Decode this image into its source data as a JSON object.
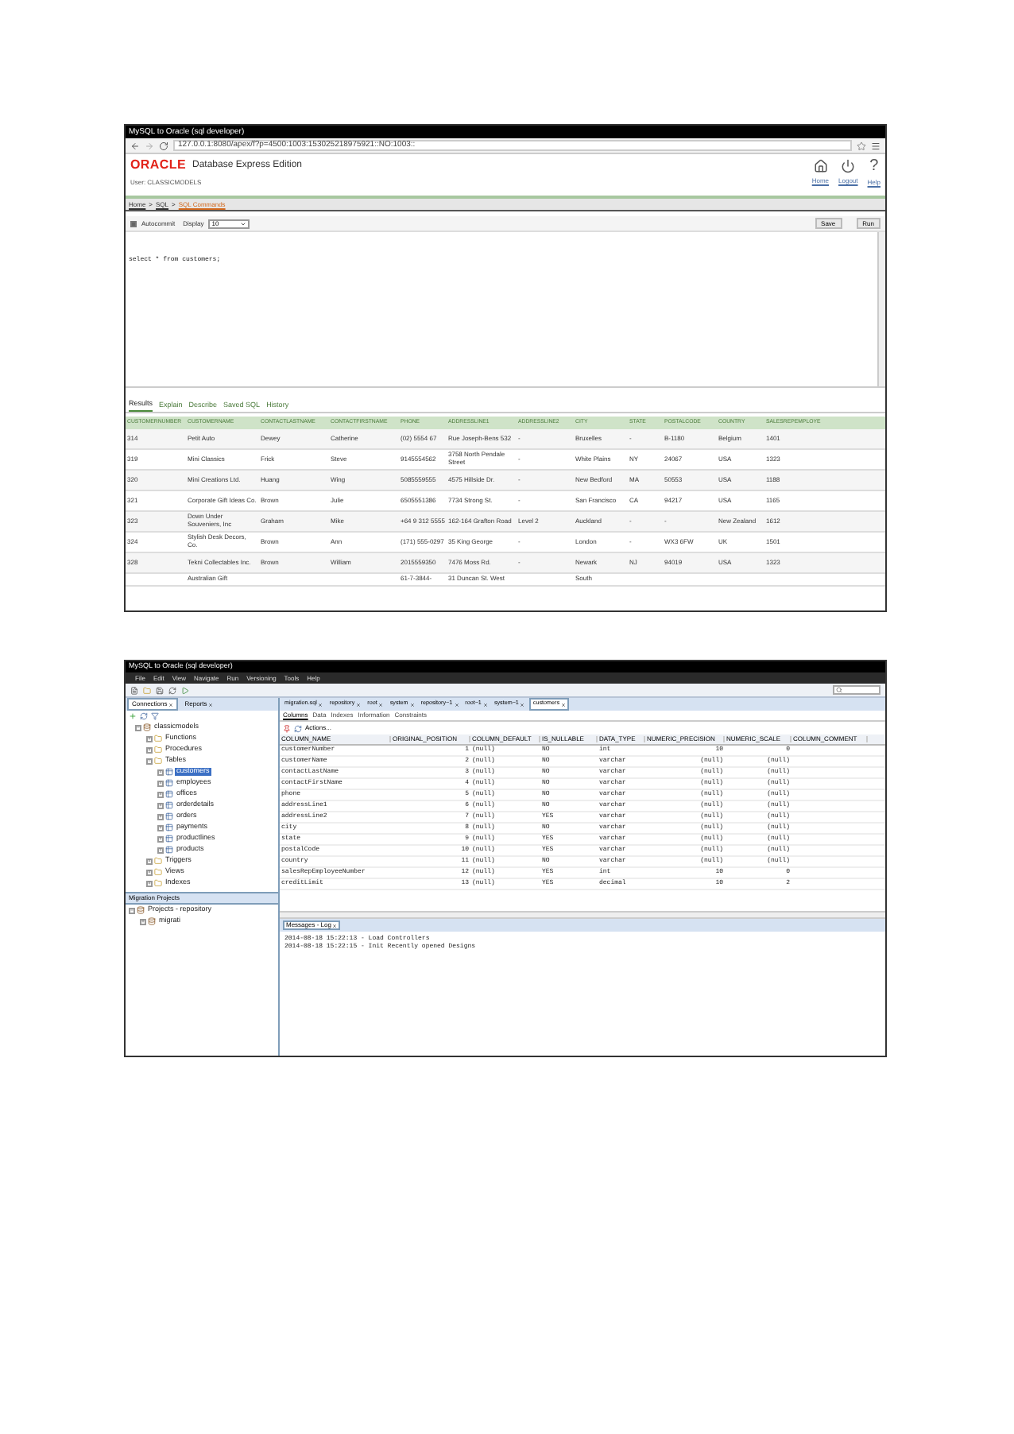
{
  "browser_window": {
    "title": "MySQL to Oracle (sql developer)",
    "url": "127.0.0.1:8080/apex/f?p=4500:1003:153025218975921::NO:1003::"
  },
  "apex": {
    "brand": "ORACLE",
    "product": "Database Express Edition",
    "header_links": [
      {
        "kind": "home",
        "label": "Home"
      },
      {
        "kind": "logout",
        "label": "Logout"
      },
      {
        "kind": "help",
        "label": "Help",
        "glyph": "?"
      }
    ],
    "user": "User: CLASSICMODELS",
    "breadcrumb_separator": ">",
    "breadcrumb": [
      {
        "label": "Home",
        "selected": false
      },
      {
        "label": "SQL",
        "selected": false
      },
      {
        "label": "SQL Commands",
        "selected": true
      }
    ],
    "autocommit": {
      "label": "Autocommit",
      "checked": true
    },
    "display": {
      "label": "Display",
      "value": "10"
    },
    "buttons": [
      "Save",
      "Run"
    ],
    "sql": "select * from customers;",
    "result_tabs": [
      {
        "label": "Results",
        "selected": true
      },
      {
        "label": "Explain",
        "selected": false
      },
      {
        "label": "Describe",
        "selected": false
      },
      {
        "label": "Saved SQL",
        "selected": false
      },
      {
        "label": "History",
        "selected": false
      }
    ],
    "results": {
      "columns": [
        "CUSTOMERNUMBER",
        "CUSTOMERNAME",
        "CONTACTLASTNAME",
        "CONTACTFIRSTNAME",
        "PHONE",
        "ADDRESSLINE1",
        "ADDRESSLINE2",
        "CITY",
        "STATE",
        "POSTALCODE",
        "COUNTRY",
        "SALESREPEMPLOYE"
      ],
      "rows": [
        [
          "314",
          "Petit Auto",
          "Dewey",
          "Catherine",
          "(02) 5554 67",
          "Rue Joseph-Bens 532",
          "-",
          "Bruxelles",
          "-",
          "B-1180",
          "Belgium",
          "1401"
        ],
        [
          "319",
          "Mini Classics",
          "Frick",
          "Steve",
          "9145554562",
          "3758 North Pendale Street",
          "-",
          "White Plains",
          "NY",
          "24067",
          "USA",
          "1323"
        ],
        [
          "320",
          "Mini Creations Ltd.",
          "Huang",
          "Wing",
          "5085559555",
          "4575 Hillside Dr.",
          "-",
          "New Bedford",
          "MA",
          "50553",
          "USA",
          "1188"
        ],
        [
          "321",
          "Corporate Gift Ideas Co.",
          "Brown",
          "Julie",
          "6505551386",
          "7734 Strong St.",
          "-",
          "San Francisco",
          "CA",
          "94217",
          "USA",
          "1165"
        ],
        [
          "323",
          "Down Under Souveniers, Inc",
          "Graham",
          "Mike",
          "+64 9 312 5555",
          "162-164 Grafton Road",
          "Level 2",
          "Auckland",
          "-",
          "-",
          "New Zealand",
          "1612"
        ],
        [
          "324",
          "Stylish Desk Decors, Co.",
          "Brown",
          "Ann",
          "(171) 555-0297",
          "35 King George",
          "-",
          "London",
          "-",
          "WX3 6FW",
          "UK",
          "1501"
        ],
        [
          "328",
          "Tekni Collectables Inc.",
          "Brown",
          "William",
          "2015559350",
          "7476 Moss Rd.",
          "-",
          "Newark",
          "NJ",
          "94019",
          "USA",
          "1323"
        ],
        [
          "",
          "Australian Gift",
          "",
          "",
          "61-7-3844-",
          "31 Duncan St. West",
          "",
          "South",
          "",
          "",
          "",
          ""
        ]
      ]
    }
  },
  "sqldev": {
    "title": "MySQL to Oracle (sql developer)",
    "menu": [
      "File",
      "Edit",
      "View",
      "Navigate",
      "Run",
      "Versioning",
      "Tools",
      "Help"
    ],
    "side_tabs": [
      {
        "label": "Connections",
        "selected": true
      },
      {
        "label": "Reports",
        "selected": false
      }
    ],
    "tree": [
      {
        "label": "classicmodels",
        "kind": "db",
        "expanded": true,
        "children": [
          {
            "label": "Functions",
            "kind": "folder",
            "expanded": false,
            "selected": false
          },
          {
            "label": "Procedures",
            "kind": "folder",
            "expanded": false,
            "selected": false
          },
          {
            "label": "Tables",
            "kind": "folder",
            "expanded": true,
            "selected": false,
            "children": [
              {
                "label": "customers",
                "kind": "table",
                "expanded": false,
                "selected": true
              },
              {
                "label": "employees",
                "kind": "table",
                "expanded": false,
                "selected": false
              },
              {
                "label": "offices",
                "kind": "table",
                "expanded": false,
                "selected": false
              },
              {
                "label": "orderdetails",
                "kind": "table",
                "expanded": false,
                "selected": false
              },
              {
                "label": "orders",
                "kind": "table",
                "expanded": false,
                "selected": false
              },
              {
                "label": "payments",
                "kind": "table",
                "expanded": false,
                "selected": false
              },
              {
                "label": "productlines",
                "kind": "table",
                "expanded": false,
                "selected": false
              },
              {
                "label": "products",
                "kind": "table",
                "expanded": false,
                "selected": false
              }
            ]
          },
          {
            "label": "Triggers",
            "kind": "folder",
            "expanded": false,
            "selected": false
          },
          {
            "label": "Views",
            "kind": "folder",
            "expanded": false,
            "selected": false
          },
          {
            "label": "Indexes",
            "kind": "folder",
            "expanded": false,
            "selected": false
          }
        ]
      }
    ],
    "migration_panel": {
      "title": "Migration Projects",
      "items": [
        {
          "label": "Projects - repository",
          "kind": "db",
          "expanded": true,
          "children": [
            {
              "label": "migrati",
              "kind": "db",
              "expanded": false,
              "selected": false
            }
          ]
        }
      ]
    },
    "editor_tabs": [
      {
        "label": "migration.sql",
        "selected": false
      },
      {
        "label": "repository",
        "selected": false
      },
      {
        "label": "root",
        "selected": false
      },
      {
        "label": "system",
        "selected": false
      },
      {
        "label": "repository~1",
        "selected": false
      },
      {
        "label": "root~1",
        "selected": false
      },
      {
        "label": "system~1",
        "selected": false
      },
      {
        "label": "customers",
        "selected": true
      }
    ],
    "sub_tabs": [
      {
        "label": "Columns",
        "selected": true
      },
      {
        "label": "Data",
        "selected": false
      },
      {
        "label": "Indexes",
        "selected": false
      },
      {
        "label": "Information",
        "selected": false
      },
      {
        "label": "Constraints",
        "selected": false
      }
    ],
    "actions": "Actions...",
    "columns_table": {
      "columns": [
        "COLUMN_NAME",
        "ORIGINAL_POSITION",
        "COLUMN_DEFAULT",
        "IS_NULLABLE",
        "DATA_TYPE",
        "NUMERIC_PRECISION",
        "NUMERIC_SCALE",
        "COLUMN_COMMENT"
      ],
      "rows": [
        [
          "customerNumber",
          "1",
          "(null)",
          "NO",
          "int",
          "10",
          "0",
          ""
        ],
        [
          "customerName",
          "2",
          "(null)",
          "NO",
          "varchar",
          "(null)",
          "(null)",
          ""
        ],
        [
          "contactLastName",
          "3",
          "(null)",
          "NO",
          "varchar",
          "(null)",
          "(null)",
          ""
        ],
        [
          "contactFirstName",
          "4",
          "(null)",
          "NO",
          "varchar",
          "(null)",
          "(null)",
          ""
        ],
        [
          "phone",
          "5",
          "(null)",
          "NO",
          "varchar",
          "(null)",
          "(null)",
          ""
        ],
        [
          "addressLine1",
          "6",
          "(null)",
          "NO",
          "varchar",
          "(null)",
          "(null)",
          ""
        ],
        [
          "addressLine2",
          "7",
          "(null)",
          "YES",
          "varchar",
          "(null)",
          "(null)",
          ""
        ],
        [
          "city",
          "8",
          "(null)",
          "NO",
          "varchar",
          "(null)",
          "(null)",
          ""
        ],
        [
          "state",
          "9",
          "(null)",
          "YES",
          "varchar",
          "(null)",
          "(null)",
          ""
        ],
        [
          "postalCode",
          "10",
          "(null)",
          "YES",
          "varchar",
          "(null)",
          "(null)",
          ""
        ],
        [
          "country",
          "11",
          "(null)",
          "NO",
          "varchar",
          "(null)",
          "(null)",
          ""
        ],
        [
          "salesRepEmployeeNumber",
          "12",
          "(null)",
          "YES",
          "int",
          "10",
          "0",
          ""
        ],
        [
          "creditLimit",
          "13",
          "(null)",
          "YES",
          "decimal",
          "10",
          "2",
          ""
        ]
      ]
    },
    "log_tab": "Messages - Log",
    "log_lines": [
      "2014-08-18 15:22:13 - Load Controllers",
      "2014-08-18 15:22:15 - Init Recently opened Designs"
    ]
  }
}
